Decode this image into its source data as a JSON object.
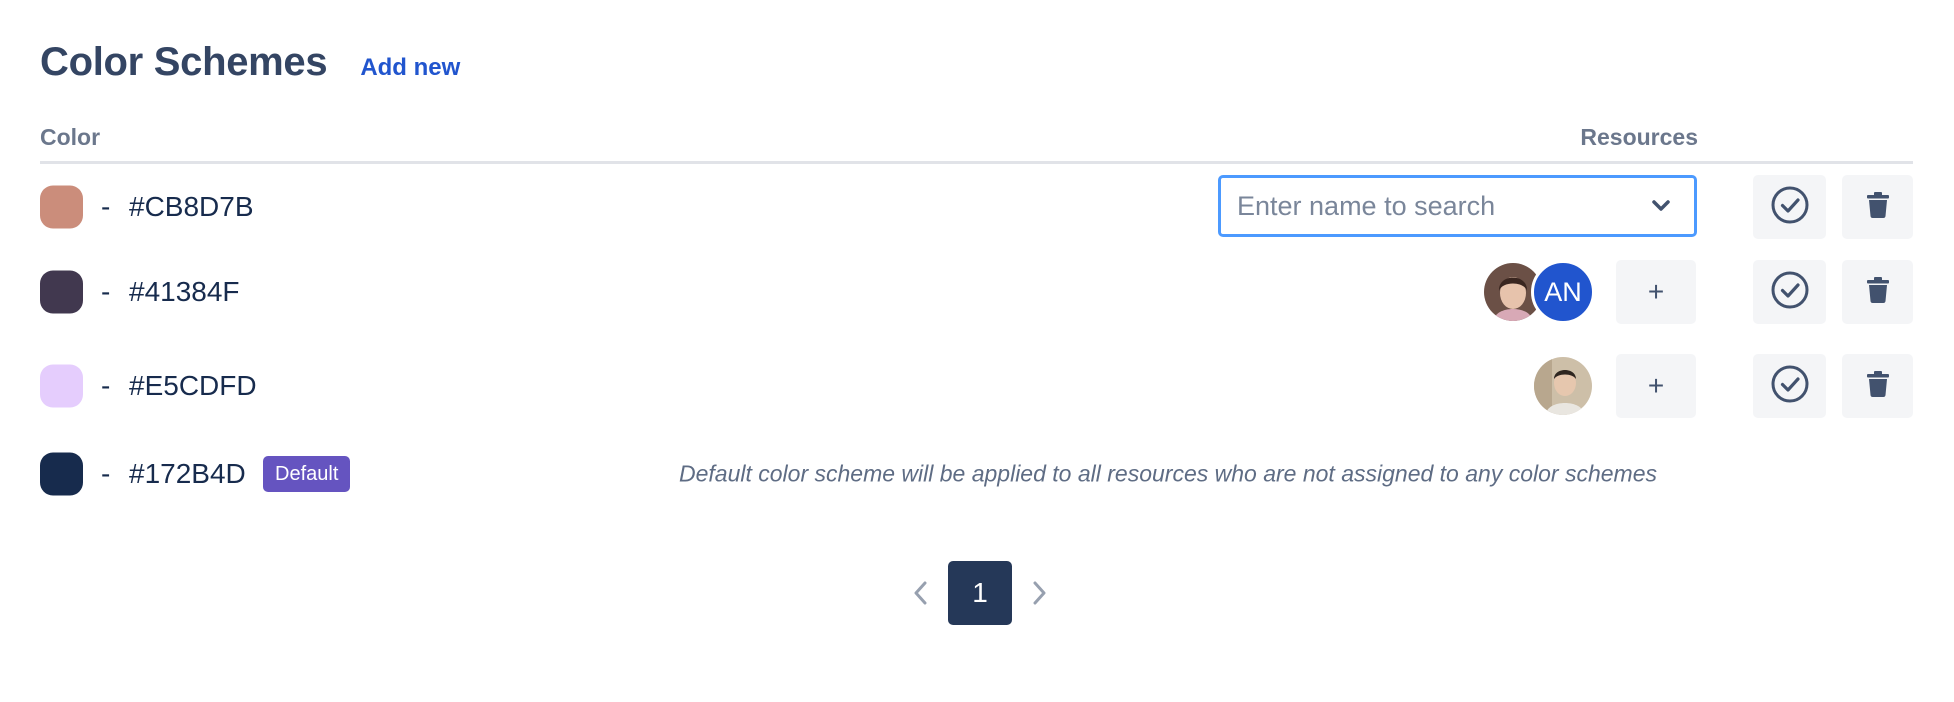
{
  "header": {
    "title": "Color Schemes",
    "add_new_label": "Add new"
  },
  "table": {
    "col_color": "Color",
    "col_resources": "Resources"
  },
  "schemes": [
    {
      "color": "#CB8D7B",
      "dash": "-",
      "hex": "#CB8D7B",
      "resource_search_placeholder": "Enter name to search"
    },
    {
      "color": "#41384F",
      "dash": "-",
      "hex": "#41384F",
      "resources": [
        {
          "type": "photo",
          "icon": "woman-portrait-avatar"
        },
        {
          "type": "initials",
          "initials": "AN"
        }
      ],
      "add_label": "+"
    },
    {
      "color": "#E5CDFD",
      "dash": "-",
      "hex": "#E5CDFD",
      "resources": [
        {
          "type": "photo",
          "icon": "man-portrait-avatar"
        }
      ],
      "add_label": "+"
    },
    {
      "color": "#172B4D",
      "dash": "-",
      "hex": "#172B4D",
      "badge": "Default",
      "note": "Default color scheme will be applied to all resources who are not assigned to any color schemes"
    }
  ],
  "icons": {
    "set_default": "check-circle-icon",
    "delete": "trash-icon",
    "dropdown": "chevron-down-icon",
    "prev": "chevron-left-icon",
    "next": "chevron-right-icon"
  },
  "pagination": {
    "current_page": "1"
  },
  "colors": {
    "accent": "#2155CE",
    "default_badge": "#6554C0",
    "focus_border": "#4C9AFF",
    "page_active": "#253858"
  }
}
